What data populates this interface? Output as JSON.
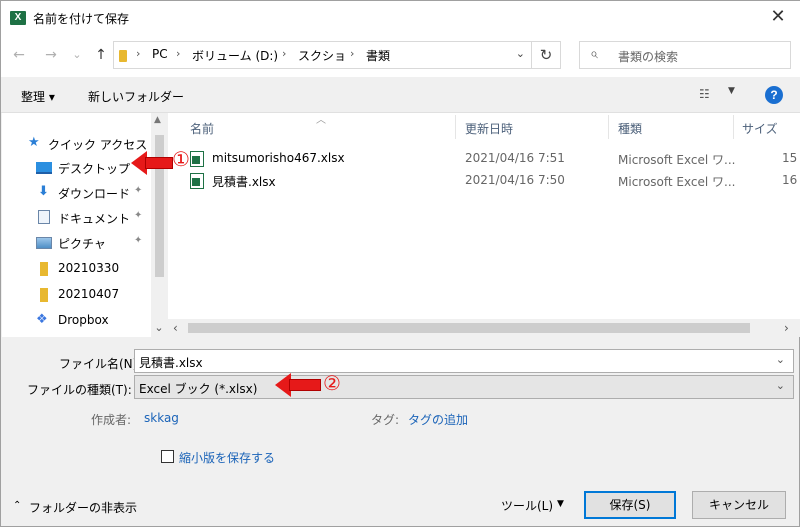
{
  "window": {
    "title": "名前を付けて保存",
    "app_icon": "X"
  },
  "nav": {
    "back": "←",
    "forward": "→",
    "history": "⌄",
    "up": "↑",
    "breadcrumb": [
      "PC",
      "ボリューム (D:)",
      "スクショ",
      "書類"
    ],
    "separator": "›",
    "refresh": "↻",
    "search_placeholder": "書類の検索"
  },
  "toolbar": {
    "organize": "整理 ▾",
    "new_folder": "新しいフォルダー"
  },
  "sidebar": {
    "items": [
      {
        "label": "クイック アクセス",
        "icon": "star-icon"
      },
      {
        "label": "デスクトップ",
        "icon": "desktop-icon",
        "pinned": true
      },
      {
        "label": "ダウンロード",
        "icon": "download-icon",
        "pinned": true
      },
      {
        "label": "ドキュメント",
        "icon": "document-icon",
        "pinned": true
      },
      {
        "label": "ピクチャ",
        "icon": "pictures-icon",
        "pinned": true
      },
      {
        "label": "20210330",
        "icon": "folder-icon"
      },
      {
        "label": "20210407",
        "icon": "folder-icon"
      },
      {
        "label": "Dropbox",
        "icon": "dropbox-icon"
      }
    ]
  },
  "files": {
    "columns": [
      "名前",
      "更新日時",
      "種類",
      "サイズ"
    ],
    "rows": [
      {
        "name": "mitsumorisho467.xlsx",
        "modified": "2021/04/16 7:51",
        "type": "Microsoft Excel ワ...",
        "size": "15"
      },
      {
        "name": "見積書.xlsx",
        "modified": "2021/04/16 7:50",
        "type": "Microsoft Excel ワ...",
        "size": "16"
      }
    ]
  },
  "form": {
    "filename_label": "ファイル名(N):",
    "filename_value": "見積書.xlsx",
    "filetype_label": "ファイルの種類(T):",
    "filetype_value": "Excel ブック (*.xlsx)",
    "author_label": "作成者:",
    "author_value": "skkag",
    "tags_label": "タグ:",
    "tags_value": "タグの追加",
    "thumbnail_label": "縮小版を保存する"
  },
  "footer": {
    "hide_folders": "フォルダーの非表示",
    "tools": "ツール(L)",
    "save": "保存(S)",
    "cancel": "キャンセル"
  },
  "annotations": {
    "one": "①",
    "two": "②",
    "color": "#e61919"
  }
}
